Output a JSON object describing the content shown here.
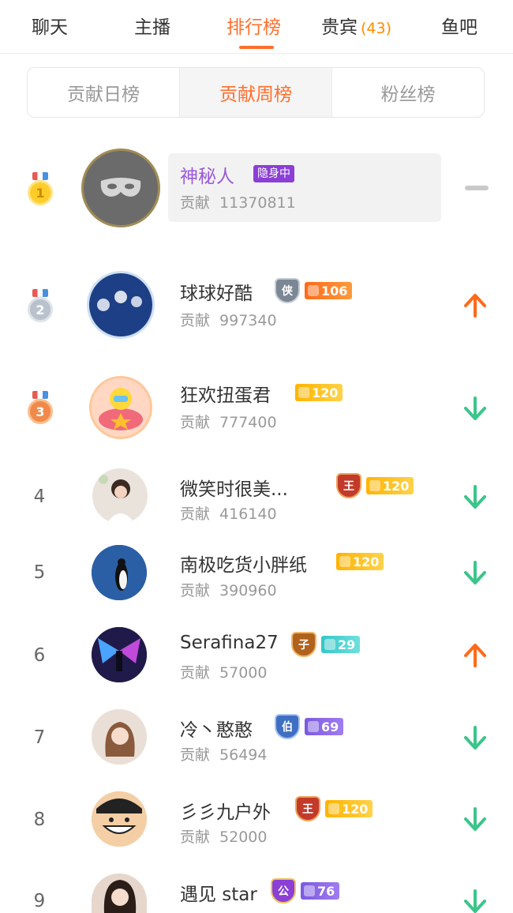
{
  "nav": {
    "tabs": [
      {
        "label": "聊天"
      },
      {
        "label": "主播"
      },
      {
        "label": "排行榜"
      },
      {
        "label": "贵宾",
        "count": "(43)"
      },
      {
        "label": "鱼吧"
      }
    ],
    "active_tab": "排行榜"
  },
  "segments": {
    "items": [
      "贡献日榜",
      "贡献周榜",
      "粉丝榜"
    ],
    "active": "贡献周榜"
  },
  "contribution_label": "贡献",
  "ranking": [
    {
      "rank": "1",
      "name": "神秘人",
      "tag": "隐身中",
      "contribution": "11370811",
      "trend": "same"
    },
    {
      "rank": "2",
      "name": "球球好酷",
      "noble": "侠",
      "level": "106",
      "contribution": "997340",
      "trend": "up"
    },
    {
      "rank": "3",
      "name": "狂欢扭蛋君",
      "level": "120",
      "contribution": "777400",
      "trend": "down"
    },
    {
      "rank": "4",
      "name": "微笑时很美...",
      "noble": "王",
      "level": "120",
      "contribution": "416140",
      "trend": "down"
    },
    {
      "rank": "5",
      "name": "南极吃货小胖纸",
      "level": "120",
      "contribution": "390960",
      "trend": "down"
    },
    {
      "rank": "6",
      "name": "Serafina27",
      "noble": "子",
      "level": "29",
      "contribution": "57000",
      "trend": "up"
    },
    {
      "rank": "7",
      "name": "冷丶憨憨",
      "noble": "伯",
      "level": "69",
      "contribution": "56494",
      "trend": "down"
    },
    {
      "rank": "8",
      "name": "彡彡九户外",
      "noble": "王",
      "level": "120",
      "contribution": "52000",
      "trend": "down"
    },
    {
      "rank": "9",
      "name": "遇见 star",
      "noble": "公",
      "level": "76",
      "contribution": "",
      "trend": "down"
    }
  ],
  "colors": {
    "accent": "#ff6f2c",
    "trend_up": "#ff6a1a",
    "trend_down": "#3cc58a",
    "hidden_name": "#9b59d9"
  },
  "icons": {
    "mask": "mask-icon",
    "arrow_up": "arrow-up-icon",
    "arrow_down": "arrow-down-icon",
    "same": "dash-icon"
  }
}
